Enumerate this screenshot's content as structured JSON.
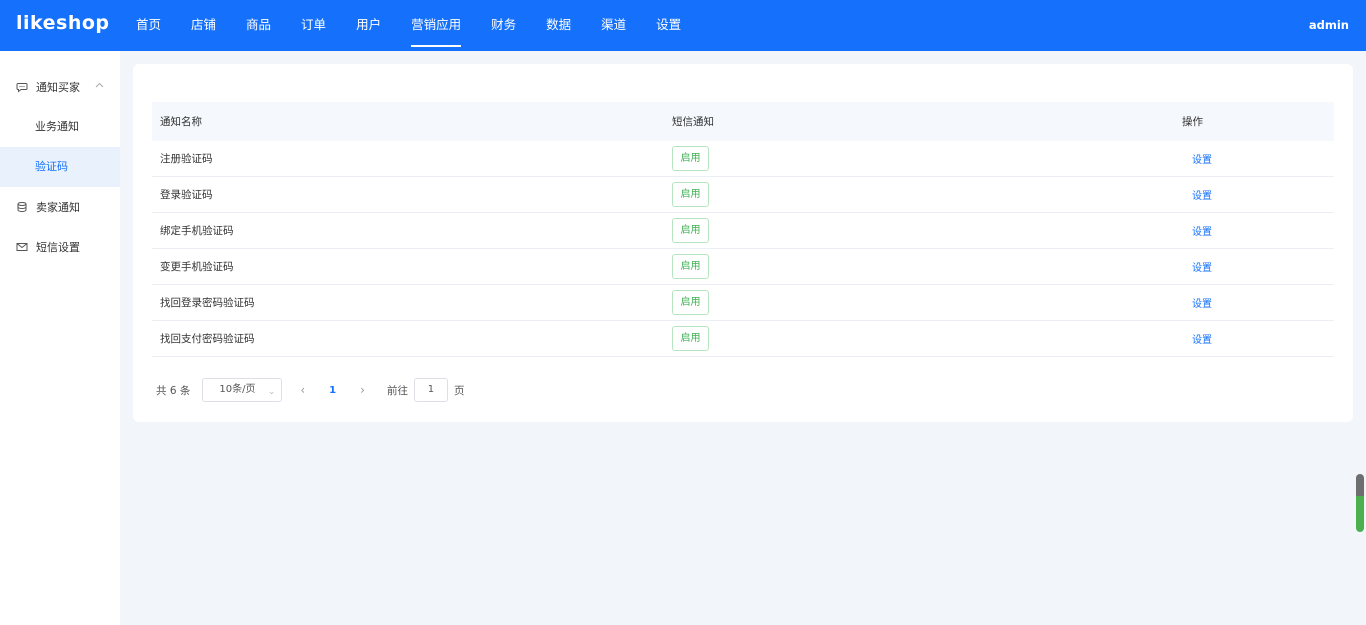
{
  "header": {
    "logo": "likeshop",
    "nav": [
      "首页",
      "店铺",
      "商品",
      "订单",
      "用户",
      "营销应用",
      "财务",
      "数据",
      "渠道",
      "设置"
    ],
    "active_nav": "营销应用",
    "user": "admin"
  },
  "sidebar": {
    "group_label": "通知买家",
    "sub_items": [
      "业务通知",
      "验证码"
    ],
    "active_sub": "验证码",
    "items": [
      "卖家通知",
      "短信设置"
    ]
  },
  "table": {
    "headers": [
      "通知名称",
      "短信通知",
      "操作"
    ],
    "rows": [
      {
        "name": "注册验证码",
        "status": "启用",
        "action": "设置"
      },
      {
        "name": "登录验证码",
        "status": "启用",
        "action": "设置"
      },
      {
        "name": "绑定手机验证码",
        "status": "启用",
        "action": "设置"
      },
      {
        "name": "变更手机验证码",
        "status": "启用",
        "action": "设置"
      },
      {
        "name": "找回登录密码验证码",
        "status": "启用",
        "action": "设置"
      },
      {
        "name": "找回支付密码验证码",
        "status": "启用",
        "action": "设置"
      }
    ]
  },
  "pagination": {
    "total": "共 6 条",
    "page_size": "10条/页",
    "current_page": "1",
    "goto_prefix": "前往",
    "goto_value": "1",
    "goto_suffix": "页"
  },
  "colors": {
    "primary": "#1570fc",
    "success": "#40b057",
    "background": "#f2f5f9"
  }
}
